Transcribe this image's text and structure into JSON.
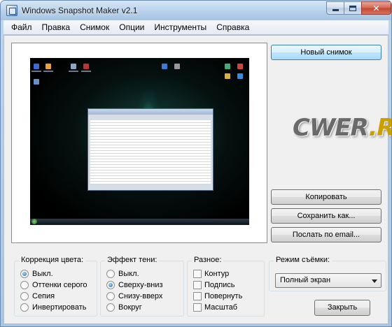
{
  "window": {
    "title": "Windows Snapshot Maker v2.1"
  },
  "menu": [
    "Файл",
    "Правка",
    "Снимок",
    "Опции",
    "Инструменты",
    "Справка"
  ],
  "buttons": {
    "new_snapshot": "Новый снимок",
    "copy": "Копировать",
    "save_as": "Сохранить как...",
    "send_email": "Послать по email...",
    "close": "Закрыть"
  },
  "logo": {
    "text_main": "CWER",
    "text_accent": ".RU"
  },
  "color_correction": {
    "title": "Коррекция цвета:",
    "options": [
      "Выкл.",
      "Оттенки серого",
      "Сепия",
      "Инвертировать"
    ],
    "selected": "Выкл."
  },
  "shadow_effect": {
    "title": "Эффект тени:",
    "options": [
      "Выкл.",
      "Сверху-вниз",
      "Снизу-вверх",
      "Вокруг"
    ],
    "selected": "Сверху-вниз"
  },
  "misc": {
    "title": "Разное:",
    "options": [
      "Контур",
      "Подпись",
      "Повернуть",
      "Масштаб"
    ]
  },
  "capture_mode": {
    "title": "Режим съёмки:",
    "value": "Полный экран"
  },
  "colors": {
    "accent": "#3c7fb1",
    "titlebar": "#b7d0ea",
    "close_button": "#c34a33"
  }
}
